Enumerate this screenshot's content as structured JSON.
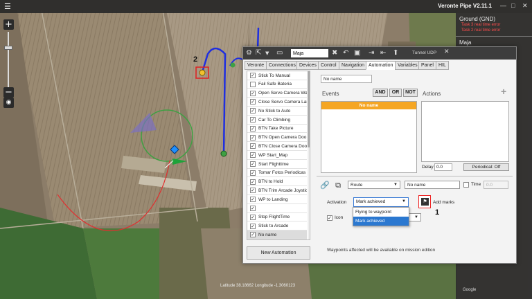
{
  "app": {
    "title": "Veronte Pipe V2.11.1",
    "window_controls": [
      "—",
      "□",
      "✕"
    ]
  },
  "map": {
    "annotation_2": "2",
    "coordinates_readout": "Latitude 38.18662  Longitude -1.3060123",
    "bottom_right_text": "Google"
  },
  "zoom": {
    "in": "+",
    "out": "−",
    "compass": "◉"
  },
  "right_panel": {
    "aircraft": [
      {
        "name": "Ground (GND)",
        "errors": [
          "Task 3 real time error",
          "Task 2 real time error"
        ]
      },
      {
        "name": "Maja",
        "errors": []
      }
    ]
  },
  "window": {
    "name_value": "Maja",
    "tunnel_label": "Tunnel UDP",
    "tabs": [
      "Veronte",
      "Connections",
      "Devices",
      "Control",
      "Navigation",
      "Automation",
      "Variables",
      "Panel",
      "HIL"
    ],
    "active_tab": "Automation",
    "automations": [
      {
        "label": "Stick To Manual",
        "checked": true
      },
      {
        "label": "Fail Safe Bateria",
        "checked": false
      },
      {
        "label": "Open Servo Camera Wa",
        "checked": true
      },
      {
        "label": "Close Servo Camera Lar",
        "checked": true
      },
      {
        "label": "No Stick to Auto",
        "checked": true
      },
      {
        "label": "Car To Climbing",
        "checked": true
      },
      {
        "label": "BTN Take Picture",
        "checked": true
      },
      {
        "label": "BTN Open Camera Doo",
        "checked": true
      },
      {
        "label": "BTN Close Camera Doo",
        "checked": true
      },
      {
        "label": "WP Start_Map",
        "checked": true
      },
      {
        "label": "Start Flighttime",
        "checked": true
      },
      {
        "label": "Tomar Fotos Periodicas",
        "checked": true
      },
      {
        "label": "BTN to Hold",
        "checked": true
      },
      {
        "label": "BTN Trim Arcade Joystic",
        "checked": true
      },
      {
        "label": "WP to Landing",
        "checked": true
      },
      {
        "label": "",
        "checked": true
      },
      {
        "label": "Stop FlightTime",
        "checked": true
      },
      {
        "label": "Stick to Arcade",
        "checked": true
      },
      {
        "label": "No name",
        "checked": true,
        "selected": true
      }
    ],
    "new_automation_label": "New Automation",
    "automation_name": "No name",
    "events_label": "Events",
    "actions_label": "Actions",
    "and_label": "AND",
    "or_label": "OR",
    "not_label": "NOT",
    "event_item": "No name",
    "add_action": "+",
    "delay_label": "Delay",
    "delay_value": "0.0",
    "periodic_label": "Periodical: Off",
    "action_type": "Route",
    "action_name": "No name",
    "time_label": "Time",
    "time_value": "0.0",
    "activation_label": "Activation",
    "activation_value": "Mark achieved",
    "activation_options": [
      "Flying to waypoint",
      "Mark achieved"
    ],
    "activation_highlight_index": 1,
    "add_marks_label": "Add marks",
    "annotation_1": "1",
    "icon_label": "Icon",
    "icon_checked": true,
    "waypoint_note": "Waypoints affected will be available on mission edition"
  }
}
